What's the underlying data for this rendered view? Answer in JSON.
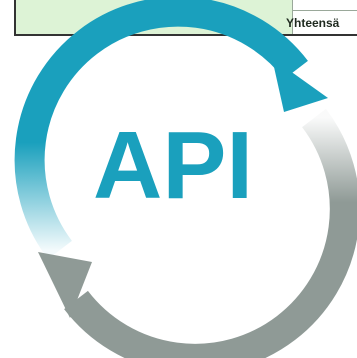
{
  "spreadsheet": {
    "cell_text": "Yhteensä"
  },
  "logo": {
    "text": "API",
    "colors": {
      "teal": "#1aa0bd",
      "gray": "#8f9a96",
      "sheet_green": "#ddf3d6"
    },
    "icons": [
      "circular-arrow-top-icon",
      "circular-arrow-bottom-icon"
    ]
  }
}
